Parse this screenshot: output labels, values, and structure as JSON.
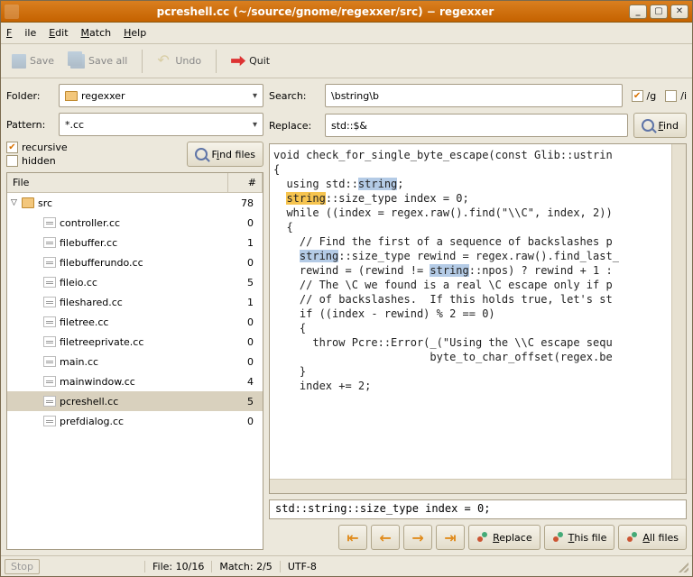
{
  "titlebar": {
    "title": "pcreshell.cc (~/source/gnome/regexxer/src) − regexxer"
  },
  "menubar": {
    "file": "File",
    "edit": "Edit",
    "match": "Match",
    "help": "Help"
  },
  "toolbar": {
    "save": "Save",
    "save_all": "Save all",
    "undo": "Undo",
    "quit": "Quit"
  },
  "left": {
    "folder_label": "Folder:",
    "folder_value": "regexxer",
    "pattern_label": "Pattern:",
    "pattern_value": "*.cc",
    "recursive_label": "recursive",
    "recursive_checked": true,
    "hidden_label": "hidden",
    "hidden_checked": false,
    "find_files_btn": "Find files",
    "tree_header_file": "File",
    "tree_header_count": "#",
    "items": [
      {
        "type": "folder",
        "name": "src",
        "count": 78,
        "expanded": true
      },
      {
        "type": "file",
        "name": "controller.cc",
        "count": 0
      },
      {
        "type": "file",
        "name": "filebuffer.cc",
        "count": 1
      },
      {
        "type": "file",
        "name": "filebufferundo.cc",
        "count": 0
      },
      {
        "type": "file",
        "name": "fileio.cc",
        "count": 5
      },
      {
        "type": "file",
        "name": "fileshared.cc",
        "count": 1
      },
      {
        "type": "file",
        "name": "filetree.cc",
        "count": 0
      },
      {
        "type": "file",
        "name": "filetreeprivate.cc",
        "count": 0
      },
      {
        "type": "file",
        "name": "main.cc",
        "count": 0
      },
      {
        "type": "file",
        "name": "mainwindow.cc",
        "count": 4
      },
      {
        "type": "file",
        "name": "pcreshell.cc",
        "count": 5,
        "selected": true
      },
      {
        "type": "file",
        "name": "prefdialog.cc",
        "count": 0
      }
    ]
  },
  "right": {
    "search_label": "Search:",
    "search_value": "\\bstring\\b",
    "flag_g": "/g",
    "flag_g_checked": true,
    "flag_i": "/i",
    "flag_i_checked": false,
    "replace_label": "Replace:",
    "replace_value": "std::$&",
    "find_btn": "Find",
    "replace_btn": "Replace",
    "this_file_btn": "This file",
    "all_files_btn": "All files",
    "result_line": "std::string::size_type index = 0;",
    "code_lines": [
      {
        "segments": [
          {
            "t": "void check_for_single_byte_escape(const Glib::ustrin"
          }
        ]
      },
      {
        "segments": [
          {
            "t": "{"
          }
        ]
      },
      {
        "segments": [
          {
            "t": "  using std::"
          },
          {
            "t": "string",
            "cls": "hl-oth"
          },
          {
            "t": ";"
          }
        ]
      },
      {
        "segments": [
          {
            "t": ""
          }
        ]
      },
      {
        "segments": [
          {
            "t": "  "
          },
          {
            "t": "string",
            "cls": "hl-cur"
          },
          {
            "t": "::size_type index = 0;"
          }
        ]
      },
      {
        "segments": [
          {
            "t": ""
          }
        ]
      },
      {
        "segments": [
          {
            "t": "  while ((index = regex.raw().find(\"\\\\C\", index, 2))"
          }
        ]
      },
      {
        "segments": [
          {
            "t": "  {"
          }
        ]
      },
      {
        "segments": [
          {
            "t": "    // Find the first of a sequence of backslashes p"
          }
        ]
      },
      {
        "segments": [
          {
            "t": "    "
          },
          {
            "t": "string",
            "cls": "hl-oth"
          },
          {
            "t": "::size_type rewind = regex.raw().find_last_"
          }
        ]
      },
      {
        "segments": [
          {
            "t": "    rewind = (rewind != "
          },
          {
            "t": "string",
            "cls": "hl-oth"
          },
          {
            "t": "::npos) ? rewind + 1 :"
          }
        ]
      },
      {
        "segments": [
          {
            "t": ""
          }
        ]
      },
      {
        "segments": [
          {
            "t": "    // The \\C we found is a real \\C escape only if p"
          }
        ]
      },
      {
        "segments": [
          {
            "t": "    // of backslashes.  If this holds true, let's st"
          }
        ]
      },
      {
        "segments": [
          {
            "t": "    if ((index - rewind) % 2 == 0)"
          }
        ]
      },
      {
        "segments": [
          {
            "t": "    {"
          }
        ]
      },
      {
        "segments": [
          {
            "t": "      throw Pcre::Error(_(\"Using the \\\\C escape sequ"
          }
        ]
      },
      {
        "segments": [
          {
            "t": "                        byte_to_char_offset(regex.be"
          }
        ]
      },
      {
        "segments": [
          {
            "t": "    }"
          }
        ]
      },
      {
        "segments": [
          {
            "t": "    index += 2;"
          }
        ]
      }
    ]
  },
  "statusbar": {
    "stop": "Stop",
    "file": "File: 10/16",
    "match": "Match: 2/5",
    "encoding": "UTF-8"
  }
}
